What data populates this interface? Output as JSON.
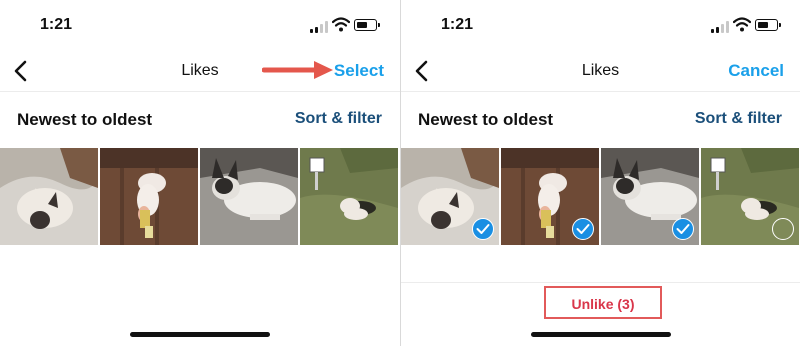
{
  "screens": [
    {
      "status": {
        "time": "1:21"
      },
      "nav": {
        "title": "Likes",
        "action": "Select"
      },
      "sort": {
        "label": "Newest to oldest",
        "button": "Sort & filter"
      }
    },
    {
      "status": {
        "time": "1:21"
      },
      "nav": {
        "title": "Likes",
        "action": "Cancel"
      },
      "sort": {
        "label": "Newest to oldest",
        "button": "Sort & filter"
      },
      "bottom": {
        "unlike_label": "Unlike (3)"
      }
    }
  ],
  "photos": [
    {
      "description_icon": "dog-on-blanket",
      "selected": true
    },
    {
      "description_icon": "dog-on-floor",
      "selected": true
    },
    {
      "description_icon": "dog-lying-bed",
      "selected": true
    },
    {
      "description_icon": "dog-in-yard",
      "selected": false
    }
  ],
  "colors": {
    "accent": "#1aa0ea",
    "sort_link": "#1b4f7a",
    "unlike": "#d9364a",
    "highlight_box": "#e25a5a",
    "arrow": "#e4574c",
    "check_fill": "#1a8fe3"
  }
}
